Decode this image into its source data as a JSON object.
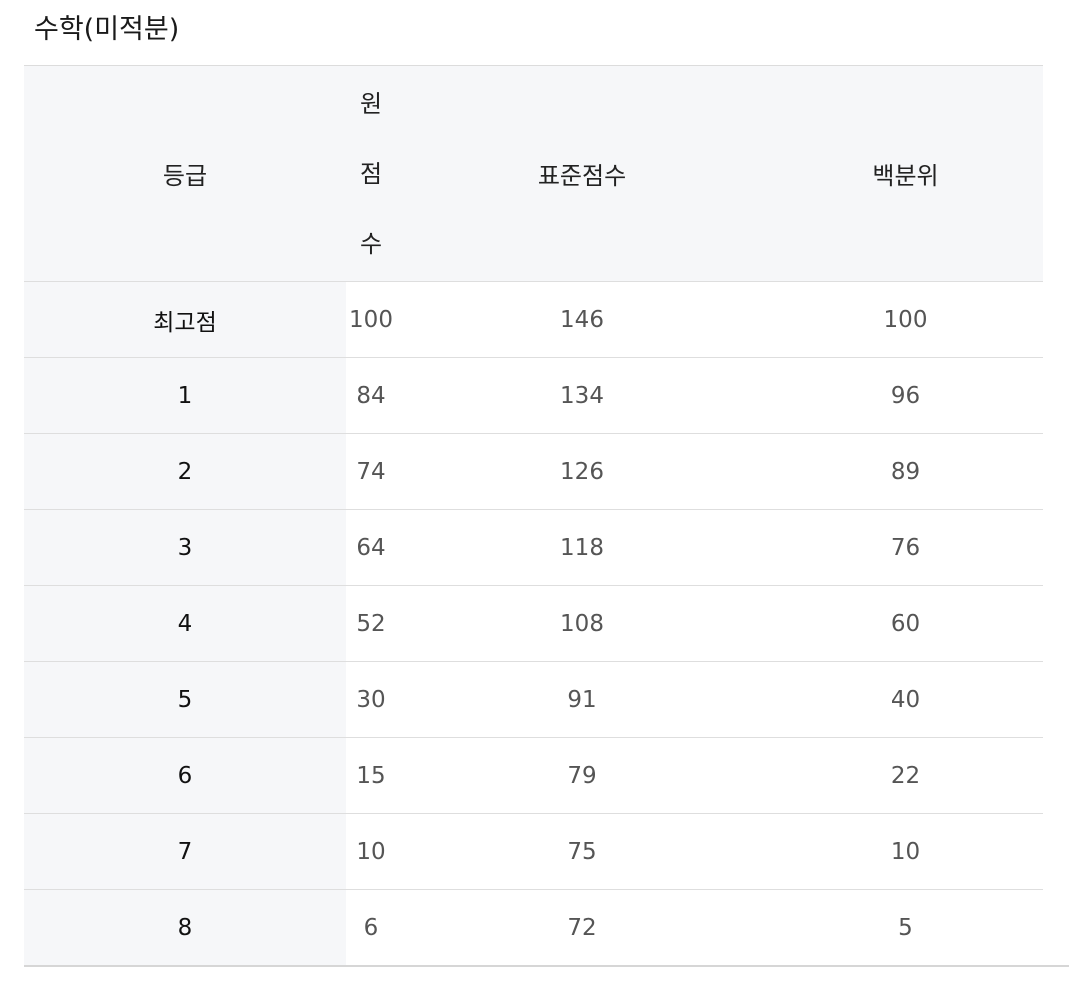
{
  "title": "수학(미적분)",
  "table": {
    "headers": {
      "grade": "등급",
      "raw_score_lines": [
        "원",
        "점",
        "수"
      ],
      "standard_score": "표준점수",
      "percentile": "백분위"
    },
    "rows": [
      {
        "grade": "최고점",
        "raw": "100",
        "standard": "146",
        "percentile": "100"
      },
      {
        "grade": "1",
        "raw": "84",
        "standard": "134",
        "percentile": "96"
      },
      {
        "grade": "2",
        "raw": "74",
        "standard": "126",
        "percentile": "89"
      },
      {
        "grade": "3",
        "raw": "64",
        "standard": "118",
        "percentile": "76"
      },
      {
        "grade": "4",
        "raw": "52",
        "standard": "108",
        "percentile": "60"
      },
      {
        "grade": "5",
        "raw": "30",
        "standard": "91",
        "percentile": "40"
      },
      {
        "grade": "6",
        "raw": "15",
        "standard": "79",
        "percentile": "22"
      },
      {
        "grade": "7",
        "raw": "10",
        "standard": "75",
        "percentile": "10"
      },
      {
        "grade": "8",
        "raw": "6",
        "standard": "72",
        "percentile": "5"
      }
    ]
  }
}
